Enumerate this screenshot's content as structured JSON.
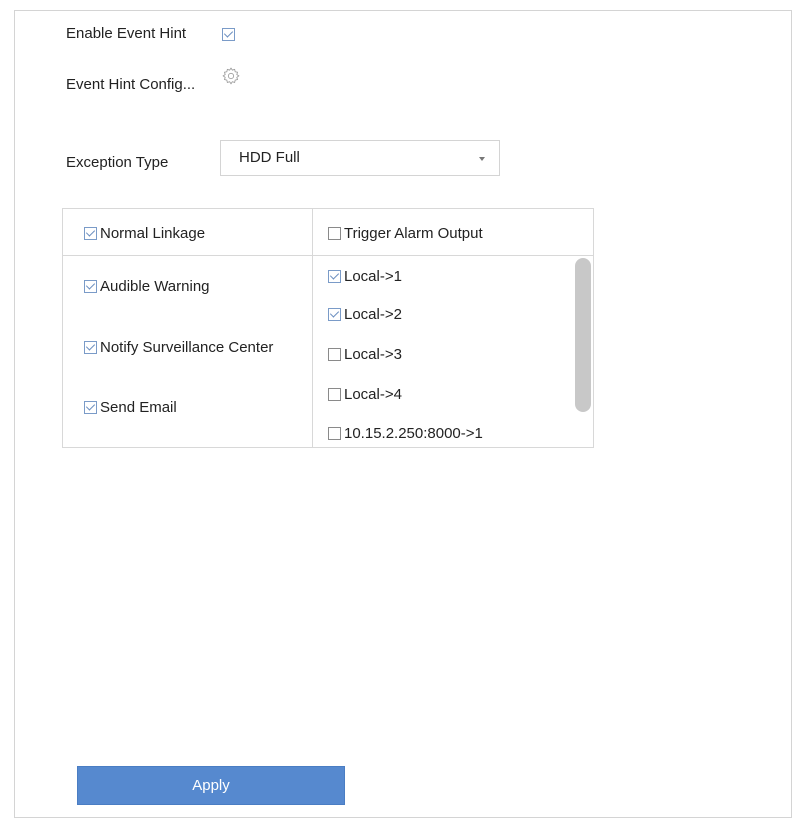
{
  "event_hint": {
    "enable_label": "Enable Event Hint",
    "enable_checked": true,
    "config_label": "Event Hint Config...",
    "config_icon": "gear-icon"
  },
  "exception": {
    "label": "Exception Type",
    "selected": "HDD Full"
  },
  "linkage": {
    "normal_header": "Normal Linkage",
    "normal_header_checked": true,
    "alarm_header": "Trigger Alarm Output",
    "alarm_header_checked": false,
    "normal_items": [
      {
        "label": "Audible Warning",
        "checked": true
      },
      {
        "label": "Notify Surveillance Center",
        "checked": true
      },
      {
        "label": "Send Email",
        "checked": true
      }
    ],
    "alarm_items": [
      {
        "label": "Local->1",
        "checked": true
      },
      {
        "label": "Local->2",
        "checked": true
      },
      {
        "label": "Local->3",
        "checked": false
      },
      {
        "label": "Local->4",
        "checked": false
      },
      {
        "label": "10.15.2.250:8000->1",
        "checked": false
      }
    ]
  },
  "actions": {
    "apply_label": "Apply"
  },
  "colors": {
    "accent": "#5689cf",
    "check": "#6c8fc0",
    "border": "#d4d4d4"
  }
}
